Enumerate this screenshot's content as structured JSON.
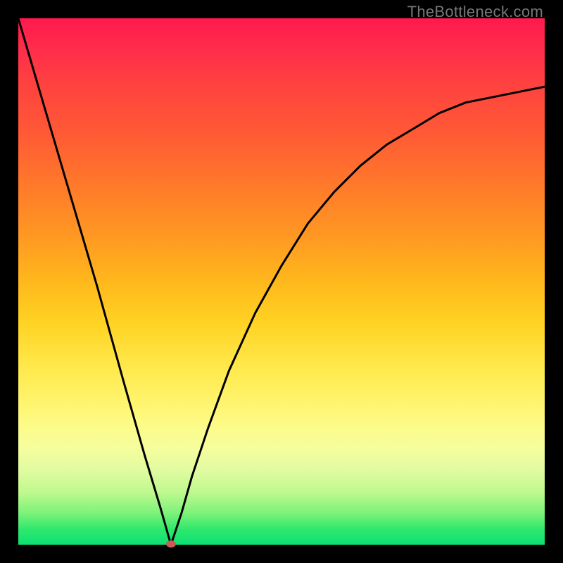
{
  "watermark": "TheBottleneck.com",
  "colors": {
    "background": "#000000",
    "gradient_top": "#ff1a4d",
    "gradient_bottom": "#0ce073",
    "curve": "#000000",
    "marker": "#cc5b53"
  },
  "chart_data": {
    "type": "line",
    "title": "",
    "xlabel": "",
    "ylabel": "",
    "xlim": [
      0,
      100
    ],
    "ylim": [
      0,
      100
    ],
    "marker": {
      "x": 29,
      "y": 0
    },
    "curve_points": [
      {
        "x": 0,
        "y": 100
      },
      {
        "x": 5,
        "y": 83
      },
      {
        "x": 10,
        "y": 66
      },
      {
        "x": 15,
        "y": 49
      },
      {
        "x": 20,
        "y": 31
      },
      {
        "x": 24,
        "y": 17
      },
      {
        "x": 27,
        "y": 7
      },
      {
        "x": 29,
        "y": 0
      },
      {
        "x": 31,
        "y": 6
      },
      {
        "x": 33,
        "y": 13
      },
      {
        "x": 36,
        "y": 22
      },
      {
        "x": 40,
        "y": 33
      },
      {
        "x": 45,
        "y": 44
      },
      {
        "x": 50,
        "y": 53
      },
      {
        "x": 55,
        "y": 61
      },
      {
        "x": 60,
        "y": 67
      },
      {
        "x": 65,
        "y": 72
      },
      {
        "x": 70,
        "y": 76
      },
      {
        "x": 75,
        "y": 79
      },
      {
        "x": 80,
        "y": 82
      },
      {
        "x": 85,
        "y": 84
      },
      {
        "x": 90,
        "y": 85
      },
      {
        "x": 95,
        "y": 86
      },
      {
        "x": 100,
        "y": 87
      }
    ]
  }
}
